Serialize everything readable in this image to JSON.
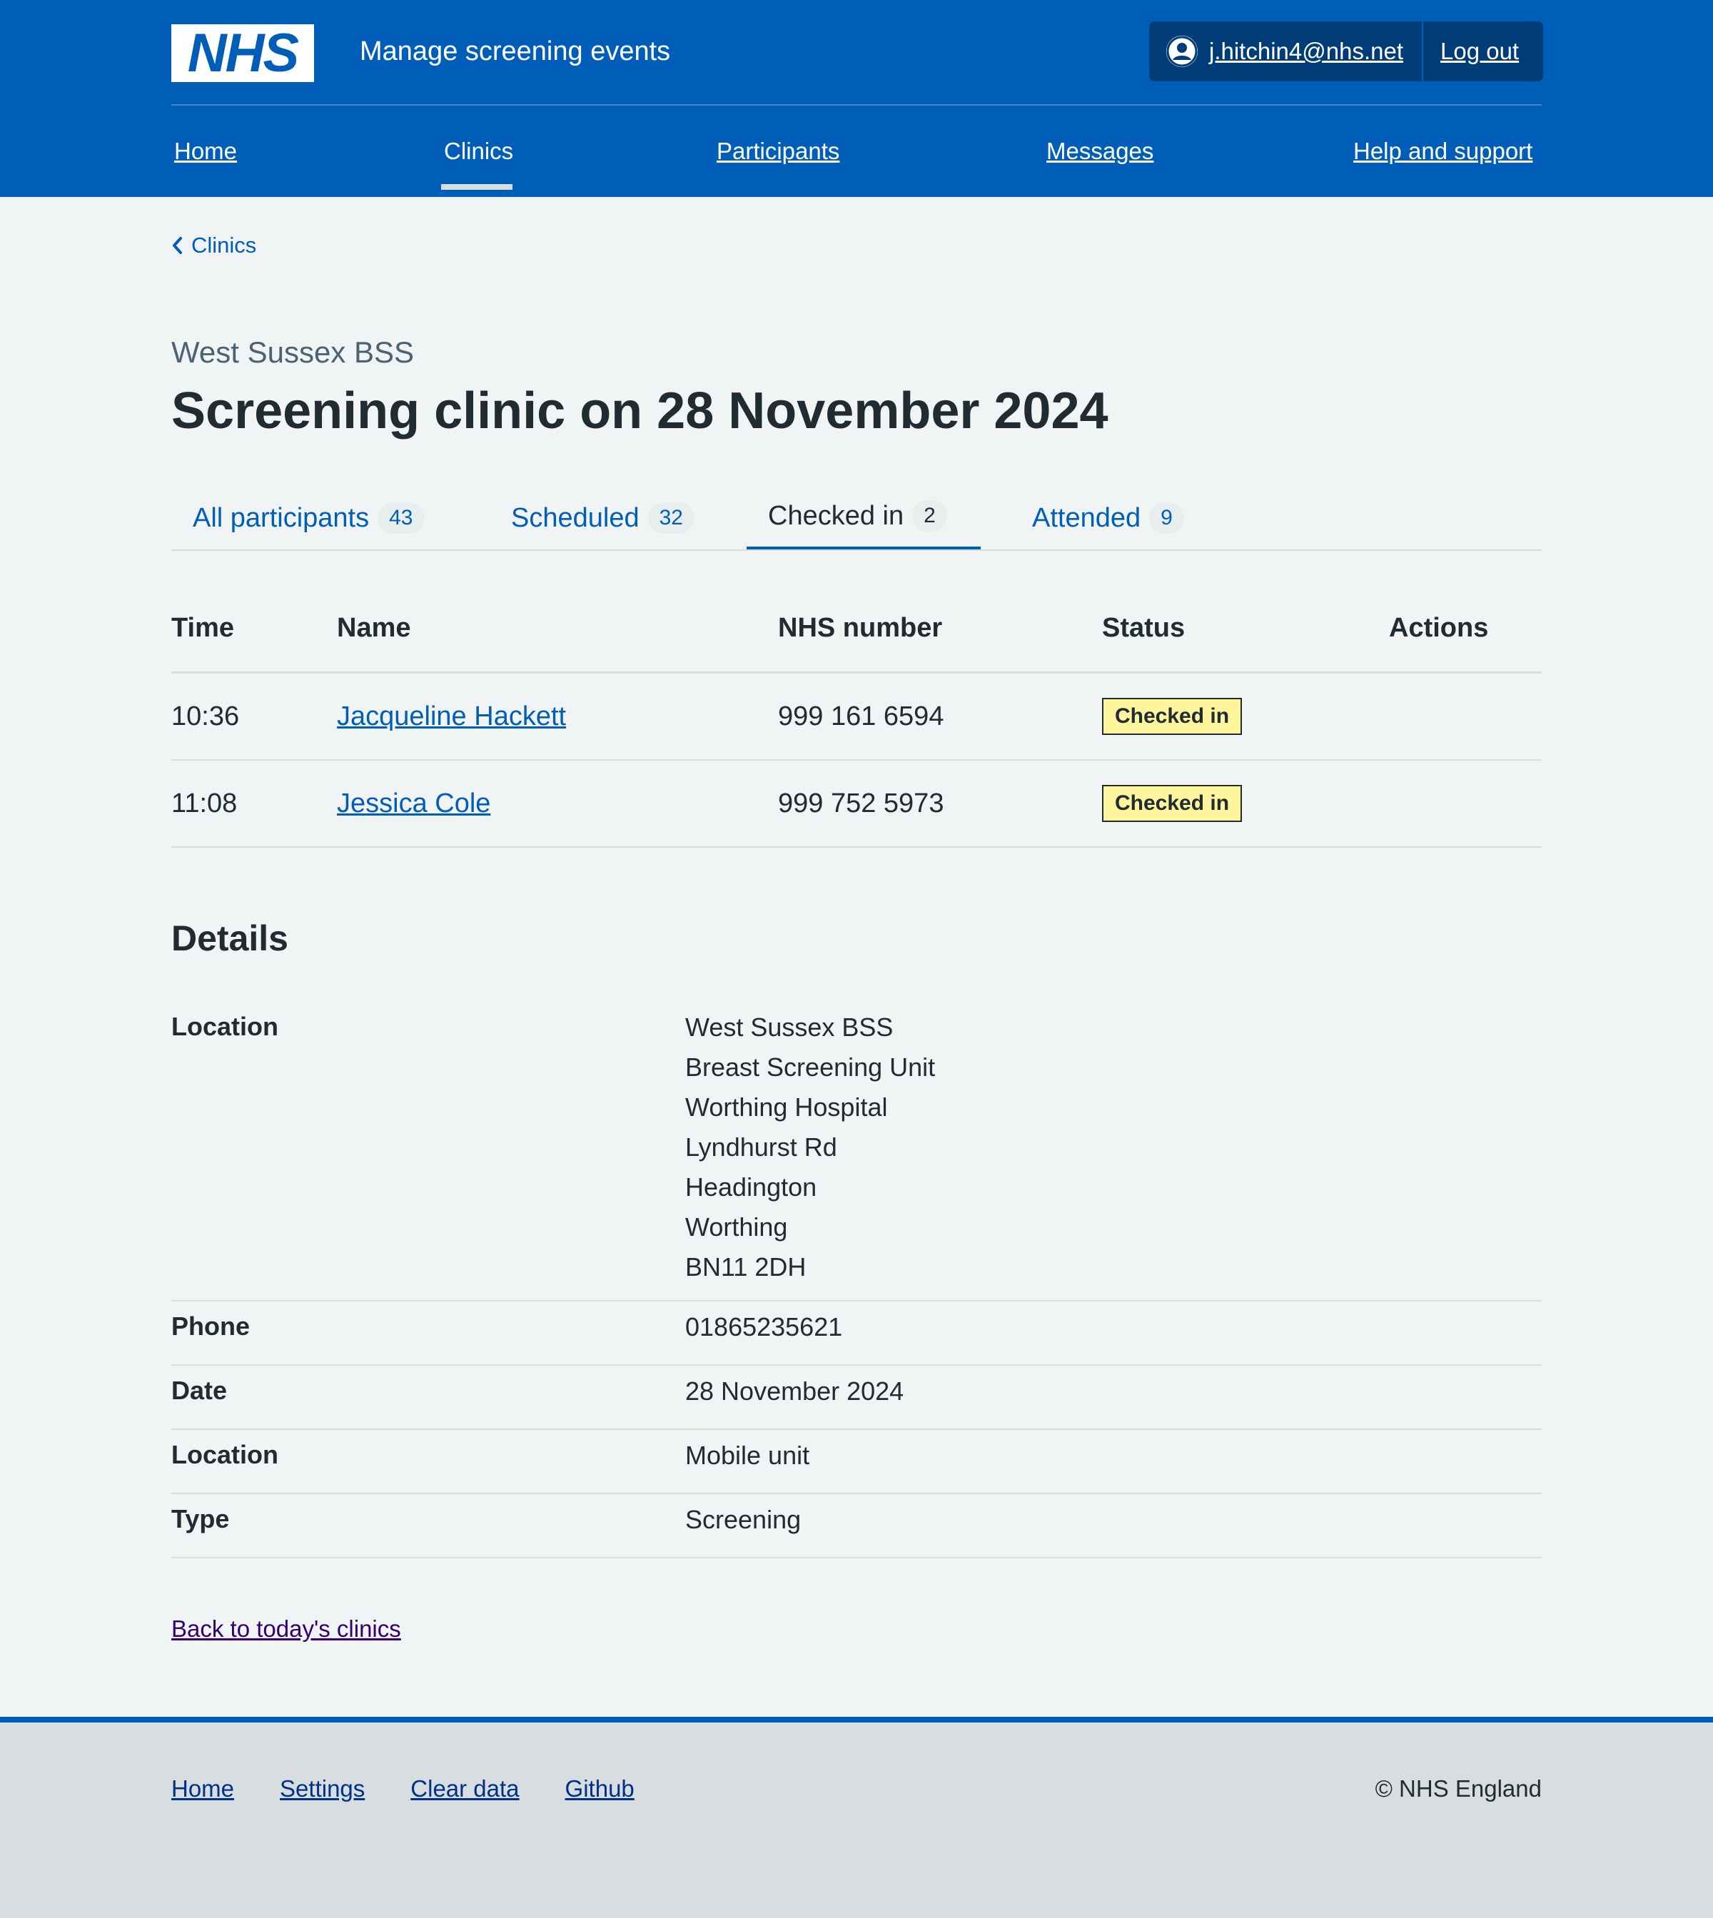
{
  "header": {
    "logo_text": "NHS",
    "service_name": "Manage screening events",
    "account": {
      "email": "j.hitchin4@nhs.net",
      "logout_label": "Log out"
    },
    "nav": [
      {
        "label": "Home",
        "current": false
      },
      {
        "label": "Clinics",
        "current": true
      },
      {
        "label": "Participants",
        "current": false
      },
      {
        "label": "Messages",
        "current": false
      },
      {
        "label": "Help and support",
        "current": false
      }
    ]
  },
  "breadcrumb": {
    "label": "Clinics"
  },
  "caption": "West Sussex BSS",
  "title": "Screening clinic on 28 November 2024",
  "tabs": [
    {
      "label": "All participants",
      "count": "43",
      "current": false
    },
    {
      "label": "Scheduled",
      "count": "32",
      "current": false
    },
    {
      "label": "Checked in",
      "count": "2",
      "current": true
    },
    {
      "label": "Attended",
      "count": "9",
      "current": false
    }
  ],
  "table": {
    "headers": {
      "time": "Time",
      "name": "Name",
      "nhs": "NHS number",
      "status": "Status",
      "actions": "Actions"
    },
    "rows": [
      {
        "time": "10:36",
        "name": "Jacqueline Hackett",
        "nhs": "999 161 6594",
        "status": "Checked in"
      },
      {
        "time": "11:08",
        "name": "Jessica Cole",
        "nhs": "999 752 5973",
        "status": "Checked in"
      }
    ]
  },
  "details": {
    "title": "Details",
    "location_key": "Location",
    "location_lines": [
      "West Sussex BSS",
      "Breast Screening Unit",
      "Worthing Hospital",
      "Lyndhurst Rd",
      "Headington",
      "Worthing",
      "BN11 2DH"
    ],
    "phone_key": "Phone",
    "phone": "01865235621",
    "date_key": "Date",
    "date": "28 November 2024",
    "location2_key": "Location",
    "location2": "Mobile unit",
    "type_key": "Type",
    "type": "Screening"
  },
  "back_link": "Back to today's clinics",
  "footer": {
    "links": [
      "Home",
      "Settings",
      "Clear data",
      "Github"
    ],
    "copyright": "© NHS England"
  },
  "colors": {
    "brand": "#005eb8",
    "tag_yellow": "#fff59d",
    "background": "#f0f4f5",
    "footer": "#d8dde0"
  }
}
